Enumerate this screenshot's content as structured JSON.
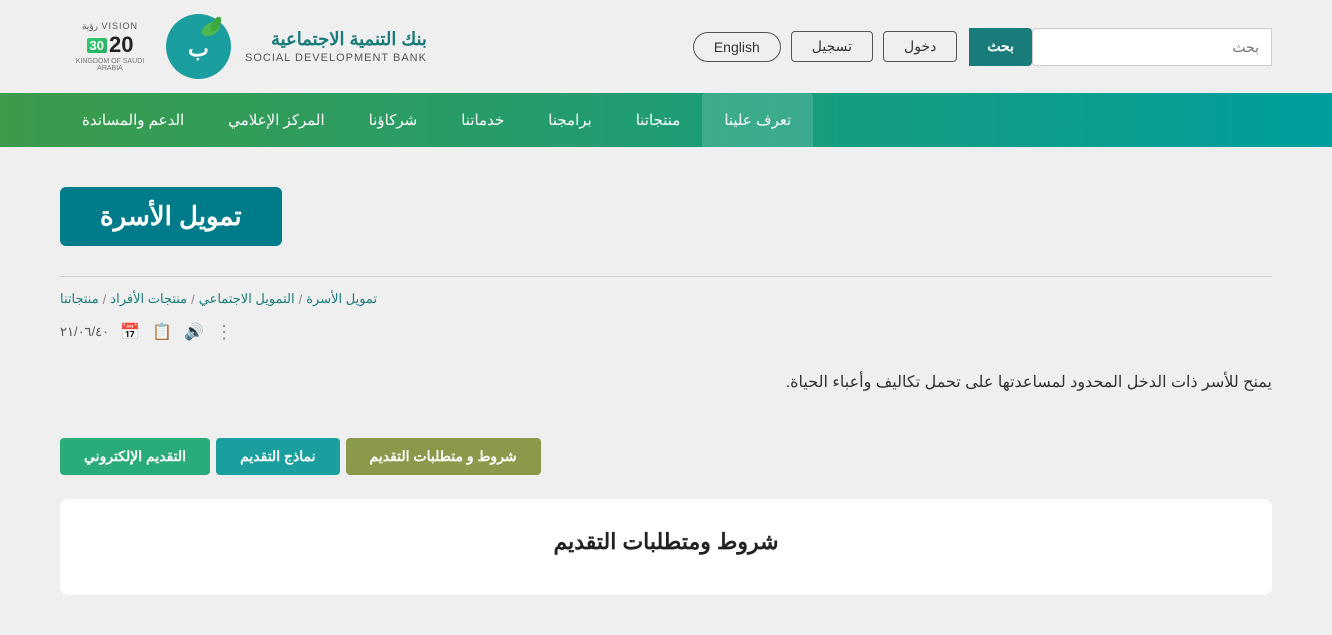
{
  "topbar": {
    "search_placeholder": "بحث",
    "search_btn_label": "بحث",
    "login_label": "دخول",
    "register_label": "تسجيل",
    "english_label": "English"
  },
  "logo": {
    "bank_name_arabic": "بنك التنمية الاجتماعية",
    "bank_name_english": "SOCIAL DEVELOPMENT BANK",
    "vision_label": "VISION رؤية",
    "vision_number": "20",
    "vision_highlight": "30",
    "vision_subtitle": "KINGDOM OF SAUDI ARABIA"
  },
  "nav": {
    "items": [
      {
        "label": "تعرف علينا"
      },
      {
        "label": "منتجاتنا"
      },
      {
        "label": "برامجنا"
      },
      {
        "label": "خدماتنا"
      },
      {
        "label": "شركاؤنا"
      },
      {
        "label": "المركز الإعلامي"
      },
      {
        "label": "الدعم والمساندة"
      }
    ]
  },
  "hero": {
    "title": "تمويل الأسرة"
  },
  "breadcrumb": {
    "items": [
      {
        "label": "منتجاتنا"
      },
      {
        "label": "منتجات الأفراد"
      },
      {
        "label": "التمويل الاجتماعي"
      },
      {
        "label": "تمويل الأسرة"
      }
    ],
    "separator": "/"
  },
  "date": {
    "value": "٢١/٠٦/٤٠"
  },
  "description": {
    "text": "يمنح للأسر ذات الدخل المحدود لمساعدتها على تحمل تكاليف وأعباء الحياة."
  },
  "tabs": [
    {
      "label": "شروط و متطلبات التقديم",
      "style": "olive"
    },
    {
      "label": "نماذج التقديم",
      "style": "teal"
    },
    {
      "label": "التقديم الإلكتروني",
      "style": "green"
    }
  ],
  "content_card": {
    "title": "شروط ومتطلبات التقديم"
  }
}
